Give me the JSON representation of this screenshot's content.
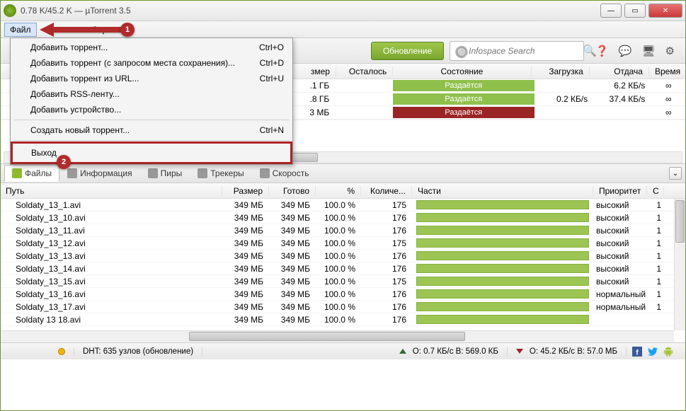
{
  "window": {
    "title": "0.78 K/45.2 K — µTorrent 3.5"
  },
  "menubar": {
    "file": "Файл",
    "rest": "Спра"
  },
  "dropdown": {
    "add_torrent": "Добавить торрент...",
    "add_torrent_sc": "Ctrl+O",
    "add_torrent_ask": "Добавить торрент (с запросом места сохранения)...",
    "add_torrent_ask_sc": "Ctrl+D",
    "add_url": "Добавить торрент из URL...",
    "add_url_sc": "Ctrl+U",
    "add_rss": "Добавить RSS-ленту...",
    "add_device": "Добавить устройство...",
    "create": "Создать новый торрент...",
    "create_sc": "Ctrl+N",
    "exit": "Выход"
  },
  "callouts": {
    "one": "1",
    "two": "2"
  },
  "toolbar": {
    "update": "Обновление",
    "search_placeholder": "Infospace Search"
  },
  "torrent_cols": {
    "size": "змер",
    "remaining": "Осталось",
    "state": "Состояние",
    "download": "Загрузка",
    "upload": "Отдача",
    "time": "Время"
  },
  "torrents": [
    {
      "size": ".1 ГБ",
      "state": "Раздаётся",
      "state_cls": "green",
      "dl": "",
      "ul": "6.2 КБ/s",
      "time": "∞"
    },
    {
      "size": ".8 ГБ",
      "state": "Раздаётся",
      "state_cls": "green",
      "dl": "0.2 КБ/s",
      "ul": "37.4 КБ/s",
      "time": "∞"
    },
    {
      "size": "3 МБ",
      "state": "Раздаётся",
      "state_cls": "red",
      "dl": "",
      "ul": "",
      "time": "∞"
    }
  ],
  "tabs2": {
    "files": "Файлы",
    "info": "Информация",
    "peers": "Пиры",
    "trackers": "Трекеры",
    "speed": "Скорость"
  },
  "file_cols": {
    "path": "Путь",
    "size": "Размер",
    "done": "Готово",
    "pct": "%",
    "count": "Количе...",
    "parts": "Части",
    "priority": "Приоритет",
    "last": "С"
  },
  "files": [
    {
      "path": "Soldaty_13_1.avi",
      "size": "349 МБ",
      "done": "349 МБ",
      "pct": "100.0 %",
      "cnt": "175",
      "prio": "высокий",
      "last": "1"
    },
    {
      "path": "Soldaty_13_10.avi",
      "size": "349 МБ",
      "done": "349 МБ",
      "pct": "100.0 %",
      "cnt": "176",
      "prio": "высокий",
      "last": "1"
    },
    {
      "path": "Soldaty_13_11.avi",
      "size": "349 МБ",
      "done": "349 МБ",
      "pct": "100.0 %",
      "cnt": "176",
      "prio": "высокий",
      "last": "1"
    },
    {
      "path": "Soldaty_13_12.avi",
      "size": "349 МБ",
      "done": "349 МБ",
      "pct": "100.0 %",
      "cnt": "175",
      "prio": "высокий",
      "last": "1"
    },
    {
      "path": "Soldaty_13_13.avi",
      "size": "349 МБ",
      "done": "349 МБ",
      "pct": "100.0 %",
      "cnt": "176",
      "prio": "высокий",
      "last": "1"
    },
    {
      "path": "Soldaty_13_14.avi",
      "size": "349 МБ",
      "done": "349 МБ",
      "pct": "100.0 %",
      "cnt": "176",
      "prio": "высокий",
      "last": "1"
    },
    {
      "path": "Soldaty_13_15.avi",
      "size": "349 МБ",
      "done": "349 МБ",
      "pct": "100.0 %",
      "cnt": "175",
      "prio": "высокий",
      "last": "1"
    },
    {
      "path": "Soldaty_13_16.avi",
      "size": "349 МБ",
      "done": "349 МБ",
      "pct": "100.0 %",
      "cnt": "176",
      "prio": "нормальный",
      "last": "1"
    },
    {
      "path": "Soldaty_13_17.avi",
      "size": "349 МБ",
      "done": "349 МБ",
      "pct": "100.0 %",
      "cnt": "176",
      "prio": "нормальный",
      "last": "1"
    },
    {
      "path": "Soldaty 13 18.avi",
      "size": "349 МБ",
      "done": "349 МБ",
      "pct": "100.0 %",
      "cnt": "176",
      "prio": "",
      "last": ""
    }
  ],
  "statusbar": {
    "dht": "DHT: 635 узлов (обновление)",
    "dl": "О: 45.2 КБ/с В: 57.0 МБ",
    "ul": "О: 0.7 КБ/с В: 569.0 КБ"
  }
}
